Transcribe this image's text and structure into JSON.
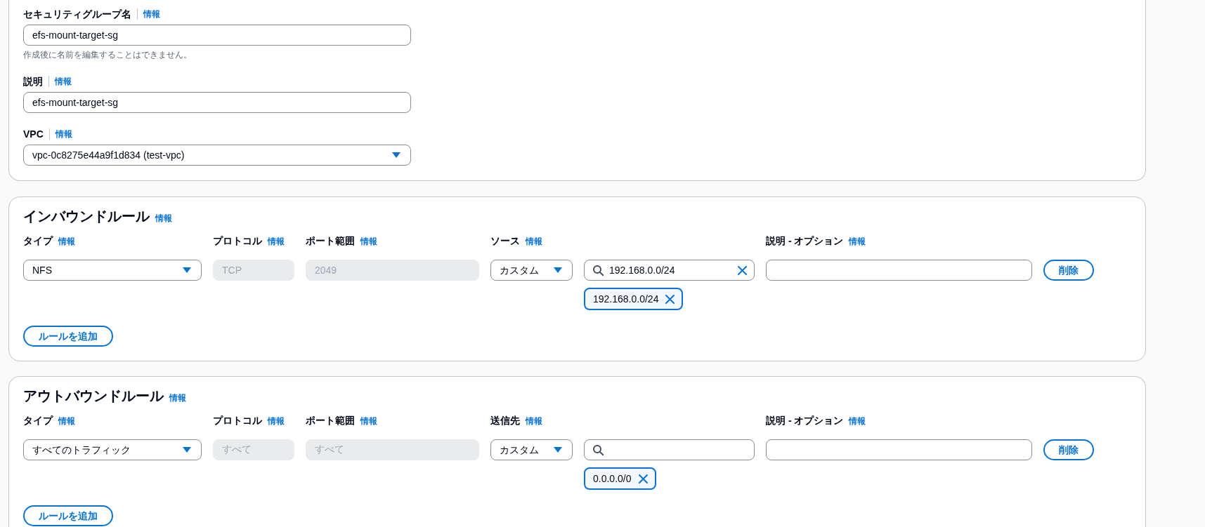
{
  "fields": [
    {
      "kind": "text",
      "label": "セキュリティグループ名",
      "info": "情報",
      "value": "efs-mount-target-sg",
      "hint": "作成後に名前を編集することはできません。"
    },
    {
      "kind": "text",
      "label": "説明",
      "info": "情報",
      "value": "efs-mount-target-sg"
    },
    {
      "kind": "select",
      "label": "VPC",
      "info": "情報",
      "value": "vpc-0c8275e44a9f1d834 (test-vpc)"
    }
  ],
  "rule_sections": [
    {
      "title": "インバウンドルール",
      "info": "情報",
      "columns": [
        {
          "label": "タイプ",
          "info": "情報"
        },
        {
          "label": "プロトコル",
          "info": "情報"
        },
        {
          "label": "ポート範囲",
          "info": "情報"
        },
        {
          "label": "ソース",
          "info": "情報"
        },
        {
          "label": "説明 - オプション",
          "info": "情報"
        }
      ],
      "rules": [
        {
          "type": "NFS",
          "protocol": {
            "value": "TCP",
            "disabled": true
          },
          "port_range": {
            "value": "2049",
            "disabled": true
          },
          "target": "カスタム",
          "search_value": "192.168.0.0/24",
          "tokens": [
            "192.168.0.0/24"
          ],
          "remove_button": "削除"
        }
      ],
      "add_button": "ルールを追加"
    },
    {
      "title": "アウトバウンドルール",
      "info": "情報",
      "columns": [
        {
          "label": "タイプ",
          "info": "情報"
        },
        {
          "label": "プロトコル",
          "info": "情報"
        },
        {
          "label": "ポート範囲",
          "info": "情報"
        },
        {
          "label": "送信先",
          "info": "情報"
        },
        {
          "label": "説明 - オプション",
          "info": "情報"
        }
      ],
      "rules": [
        {
          "type": "すべてのトラフィック",
          "protocol": {
            "value": "すべて",
            "disabled": true
          },
          "port_range": {
            "value": "すべて",
            "disabled": true
          },
          "target": "カスタム",
          "tokens": [
            "0.0.0.0/0"
          ],
          "remove_button": "削除"
        }
      ],
      "add_button": "ルールを追加"
    }
  ]
}
